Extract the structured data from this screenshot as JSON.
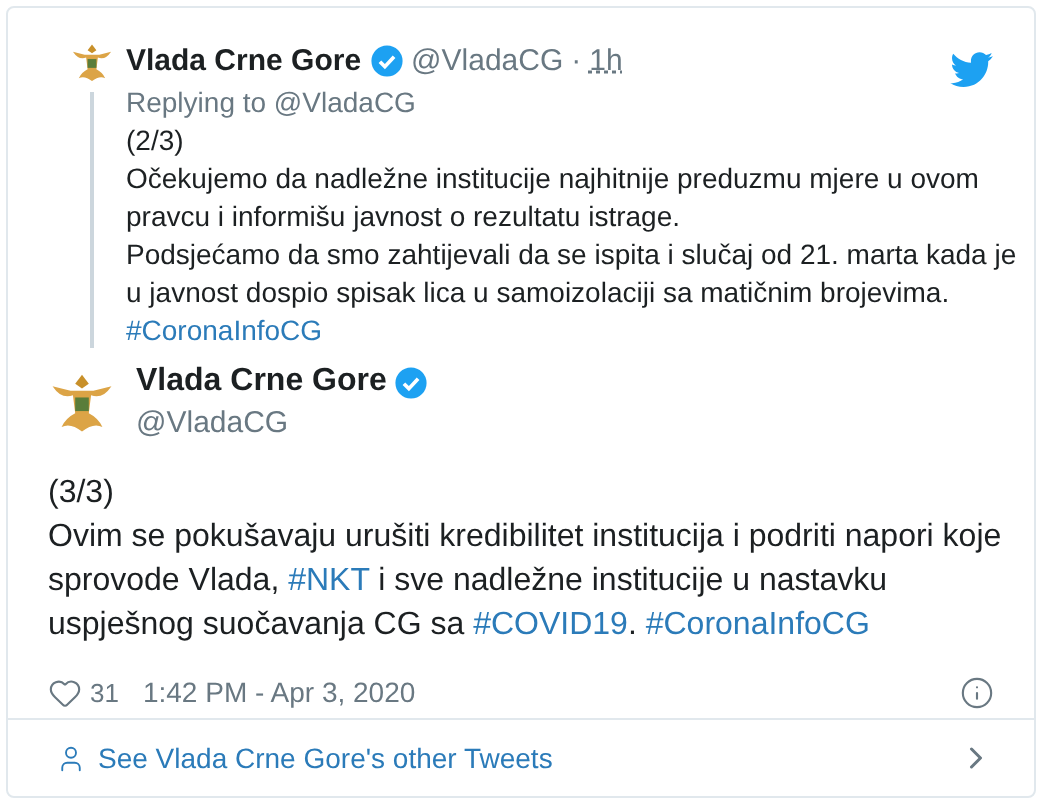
{
  "reply_tweet": {
    "name": "Vlada Crne Gore",
    "handle": "@VladaCG",
    "separator": "·",
    "time": "1h",
    "replying_to": "Replying to @VladaCG",
    "verified": true,
    "paragraphs": [
      [
        {
          "kind": "text",
          "text": "(2/3)"
        }
      ],
      [
        {
          "kind": "text",
          "text": "Očekujemo da nadležne institucije najhitnije preduzmu mjere u ovom pravcu i informišu javnost o rezultatu istrage."
        }
      ],
      [
        {
          "kind": "text",
          "text": "Podsjećamo da smo zahtijevali da se ispita i slučaj od 21. marta kada je u javnost dospio spisak lica u samoizolaciji sa matičnim brojevima."
        }
      ],
      [
        {
          "kind": "hashtag",
          "text": "#CoronaInfoCG"
        }
      ]
    ]
  },
  "main_tweet": {
    "name": "Vlada Crne Gore",
    "handle": "@VladaCG",
    "verified": true,
    "paragraphs": [
      [
        {
          "kind": "text",
          "text": "(3/3)"
        }
      ],
      [
        {
          "kind": "text",
          "text": "Ovim se pokušavaju urušiti kredibilitet institucija i podriti napori koje sprovode Vlada, "
        },
        {
          "kind": "hashtag",
          "text": "#NKT"
        },
        {
          "kind": "text",
          "text": " i sve nadležne institucije u nastavku uspješnog suočavanja CG sa "
        },
        {
          "kind": "hashtag",
          "text": "#COVID19"
        },
        {
          "kind": "text",
          "text": ". "
        },
        {
          "kind": "hashtag",
          "text": "#CoronaInfoCG"
        }
      ]
    ],
    "likes": "31",
    "timestamp": "1:42 PM - Apr 3, 2020"
  },
  "footer_link": "See Vlada Crne Gore's other Tweets"
}
